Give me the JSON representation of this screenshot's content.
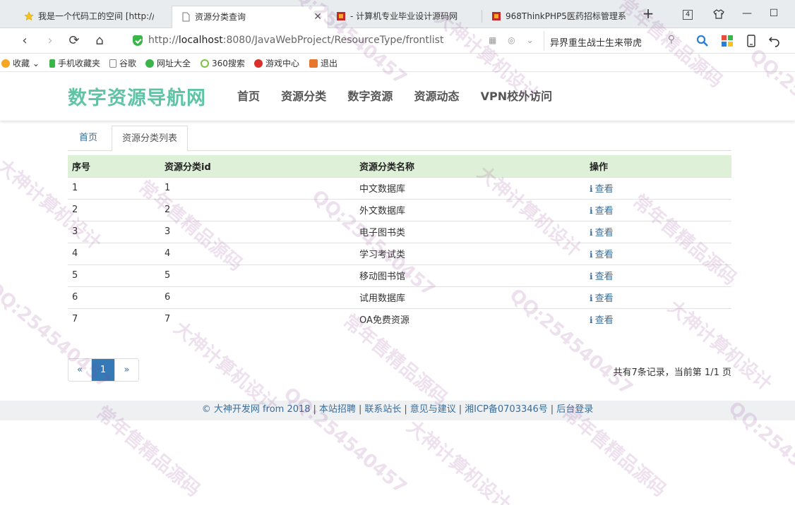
{
  "browser": {
    "tabs": [
      {
        "label": "我是一个代码工的空间 [http://...",
        "active": false
      },
      {
        "label": "资源分类查询",
        "active": true
      },
      {
        "label": "- 计算机专业毕业设计源码网",
        "active": false
      },
      {
        "label": "968ThinkPHP5医药招标管理系",
        "active": false
      }
    ],
    "new_tab": "+",
    "tab_count": "4",
    "url_prefix": "http://",
    "url_host": "localhost",
    "url_rest": ":8080/JavaWebProject/ResourceType/frontlist",
    "search_text": "异界重生战士生来带虎"
  },
  "bookmarks": [
    {
      "label": "收藏",
      "icon": "star-icon",
      "color": "#f5a623"
    },
    {
      "label": "手机收藏夹",
      "icon": "phone-icon",
      "color": "#3bb54a"
    },
    {
      "label": "谷歌",
      "icon": "page-icon",
      "color": "#ffffff"
    },
    {
      "label": "网址大全",
      "icon": "globe-icon",
      "color": "#3bb54a"
    },
    {
      "label": "360搜索",
      "icon": "search-360-icon",
      "color": "#7cc242"
    },
    {
      "label": "游戏中心",
      "icon": "game-icon",
      "color": "#d9302c"
    },
    {
      "label": "退出",
      "icon": "exit-icon",
      "color": "#e8772e"
    }
  ],
  "site": {
    "brand": "数字资源导航网",
    "nav": [
      "首页",
      "资源分类",
      "数字资源",
      "资源动态",
      "VPN校外访问"
    ]
  },
  "breadcrumb": {
    "home": "首页",
    "current": "资源分类列表"
  },
  "table": {
    "headers": [
      "序号",
      "资源分类id",
      "资源分类名称",
      "操作"
    ],
    "action_label": "查看",
    "rows": [
      {
        "no": "1",
        "id": "1",
        "name": "中文数据库"
      },
      {
        "no": "2",
        "id": "2",
        "name": "外文数据库"
      },
      {
        "no": "3",
        "id": "3",
        "name": "电子图书类"
      },
      {
        "no": "4",
        "id": "4",
        "name": "学习考试类"
      },
      {
        "no": "5",
        "id": "5",
        "name": "移动图书馆"
      },
      {
        "no": "6",
        "id": "6",
        "name": "试用数据库"
      },
      {
        "no": "7",
        "id": "7",
        "name": "OA免费资源"
      }
    ]
  },
  "pager": {
    "prev": "«",
    "current": "1",
    "next": "»",
    "summary": "共有7条记录，当前第 1/1 页"
  },
  "footer": {
    "links": [
      "© 大神开发网 from 2018",
      "本站招聘",
      "联系站长",
      "意见与建议",
      "湘ICP备0703346号",
      "后台登录"
    ],
    "separator": "|"
  },
  "watermarks": [
    "QQ:254540457",
    "大神计算机设计",
    "常年售精品源码"
  ],
  "colors": {
    "brand": "#5fc4a6",
    "link": "#3a6d99",
    "header_row": "#dff0d8",
    "pager_active": "#337ab7"
  }
}
